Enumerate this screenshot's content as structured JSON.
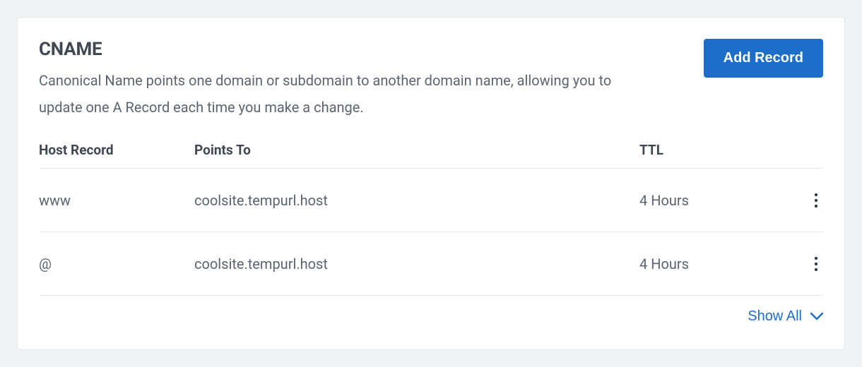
{
  "section": {
    "title": "CNAME",
    "description": "Canonical Name points one domain or subdomain to another domain name, allowing you to update one A Record each time you make a change.",
    "add_button_label": "Add Record",
    "show_all_label": "Show All"
  },
  "table": {
    "headers": {
      "host": "Host Record",
      "points_to": "Points To",
      "ttl": "TTL"
    },
    "rows": [
      {
        "host": "www",
        "points_to": "coolsite.tempurl.host",
        "ttl": "4 Hours"
      },
      {
        "host": "@",
        "points_to": "coolsite.tempurl.host",
        "ttl": "4 Hours"
      }
    ]
  }
}
